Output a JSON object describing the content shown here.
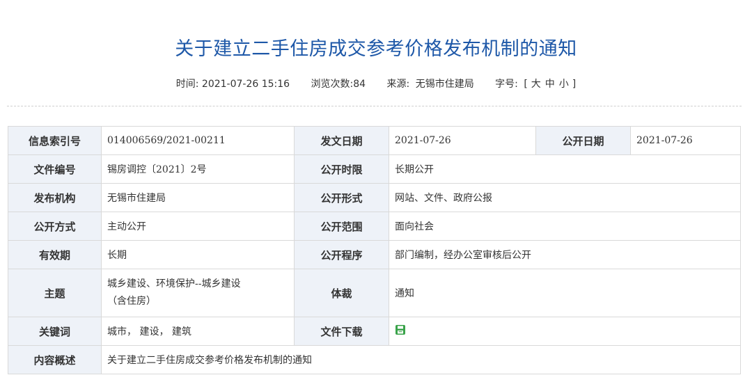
{
  "page": {
    "title": "关于建立二手住房成交参考价格发布机制的通知"
  },
  "meta": {
    "time_label": "时间:",
    "time_value": "2021-07-26 15:16",
    "views_label": "浏览次数:",
    "views_value": "84",
    "source_label": "来源:",
    "source_value": "无锡市住建局",
    "fontsize_label": "字号:",
    "bracket_open": "[",
    "size_large": "大",
    "size_medium": "中",
    "size_small": "小",
    "bracket_close": "]"
  },
  "info": {
    "index_no_label": "信息索引号",
    "index_no_value": "014006569/2021-00211",
    "issue_date_label": "发文日期",
    "issue_date_value": "2021-07-26",
    "public_date_label": "公开日期",
    "public_date_value": "2021-07-26",
    "doc_no_label": "文件编号",
    "doc_no_value": "锡房调控〔2021〕2号",
    "public_period_label": "公开时限",
    "public_period_value": "长期公开",
    "publisher_label": "发布机构",
    "publisher_value": "无锡市住建局",
    "public_form_label": "公开形式",
    "public_form_value": "网站、文件、政府公报",
    "public_mode_label": "公开方式",
    "public_mode_value": "主动公开",
    "public_scope_label": "公开范围",
    "public_scope_value": "面向社会",
    "validity_label": "有效期",
    "validity_value": "长期",
    "procedure_label": "公开程序",
    "procedure_value": "部门编制，经办公室审核后公开",
    "topic_label": "主题",
    "topic_value_line1": "城乡建设、环境保护--城乡建设",
    "topic_value_line2": "（含住房）",
    "genre_label": "体裁",
    "genre_value": "通知",
    "keywords_label": "关键词",
    "keywords_value": "城市， 建设， 建筑",
    "download_label": "文件下载",
    "download_icon": "save-icon",
    "summary_label": "内容概述",
    "summary_value": "关于建立二手住房成交参考价格发布机制的通知"
  },
  "colors": {
    "title": "#1e58a8",
    "label_bg": "#eef2f8",
    "border": "#d9d9d9",
    "icon": "#3aa34a"
  }
}
